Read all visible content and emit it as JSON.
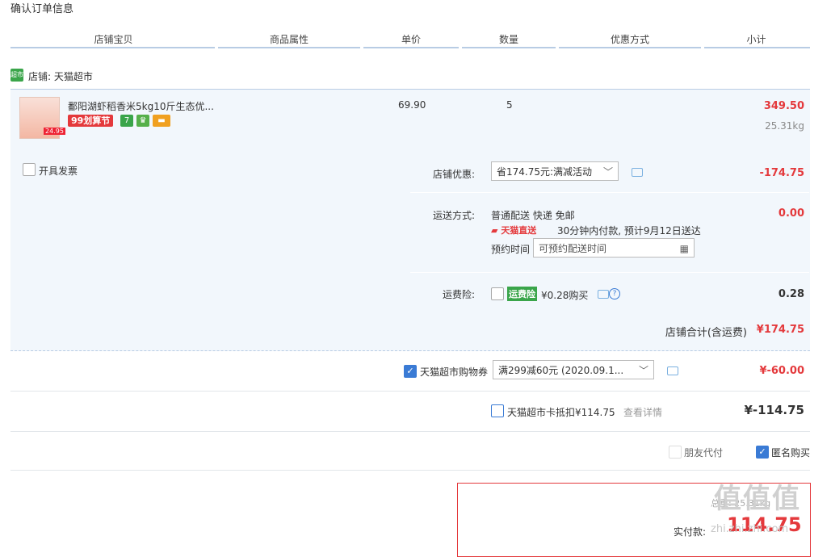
{
  "page": {
    "title": "确认订单信息"
  },
  "columns": [
    "店铺宝贝",
    "商品属性",
    "单价",
    "数量",
    "优惠方式",
    "小计"
  ],
  "shop": {
    "icon_text": "超市",
    "label": "店铺: 天猫超市"
  },
  "item": {
    "name": "鄱阳湖虾稻香米5kg10斤生态优...",
    "promo_tag": "99划算节",
    "thumb_price": "24.95",
    "unit_price": "69.90",
    "quantity": "5",
    "subtotal": "349.50",
    "weight": "25.31kg",
    "badges": [
      {
        "text": "7",
        "color": "#3aa54a"
      },
      {
        "text": "♛",
        "color": "#56b04a"
      },
      {
        "text": "▬",
        "color": "#f0a020"
      }
    ]
  },
  "invoice": {
    "label": "开具发票"
  },
  "shop_discount": {
    "label": "店铺优惠:",
    "selected": "省174.75元:满减活动",
    "value": "-174.75"
  },
  "shipping": {
    "label": "运送方式:",
    "method": "普通配送 快递 免邮",
    "badge": "天猫直送",
    "note": "30分钟内付款, 预计9月12日送达",
    "appointment_label": "预约时间",
    "appointment_placeholder": "可预约配送时间",
    "value": "0.00"
  },
  "insurance": {
    "label": "运费险:",
    "tag": "运费险",
    "text": "¥0.28购买",
    "help": "?",
    "value": "0.28"
  },
  "shop_total": {
    "label": "店铺合计(含运费)",
    "value": "¥174.75"
  },
  "coupon": {
    "label": "天猫超市购物券",
    "selected": "满299减60元 (2020.09.1...",
    "value": "¥-60.00"
  },
  "card": {
    "label": "天猫超市卡抵扣¥114.75",
    "link": "查看详情",
    "value": "¥-114.75"
  },
  "options": {
    "friend_pay": "朋友代付",
    "anonymous": "匿名购买"
  },
  "payment": {
    "weight_label": "总重: 25.31kg",
    "actual_label": "实付款:",
    "actual_value": "114.75"
  },
  "watermark": {
    "text": "值值值",
    "url": "zhi.zhi.zhi.com"
  },
  "colors": {
    "accent_red": "#e4393c",
    "panel_blue": "#f2f7fc",
    "check_blue": "#3a7bd5"
  }
}
